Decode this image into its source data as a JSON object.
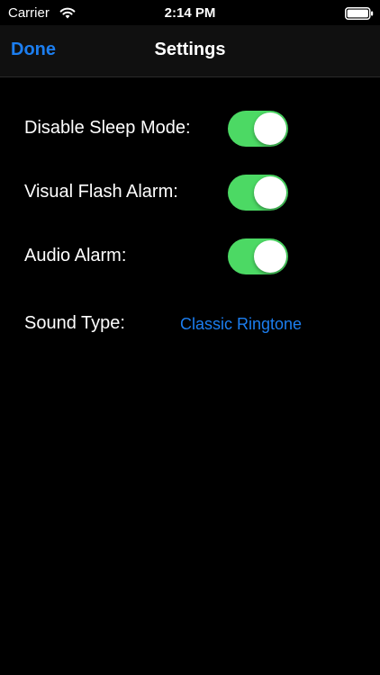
{
  "status_bar": {
    "carrier": "Carrier",
    "time": "2:14 PM",
    "wifi_icon": "wifi-icon",
    "battery_icon": "battery-icon"
  },
  "nav": {
    "done_label": "Done",
    "title": "Settings"
  },
  "settings": {
    "disable_sleep": {
      "label": "Disable Sleep Mode:",
      "on": true
    },
    "visual_flash": {
      "label": "Visual Flash Alarm:",
      "on": true
    },
    "audio_alarm": {
      "label": "Audio Alarm:",
      "on": true
    },
    "sound_type": {
      "label": "Sound Type:",
      "value": "Classic Ringtone"
    }
  },
  "colors": {
    "accent": "#1c7ef0",
    "toggle_on": "#4cd964",
    "background": "#000000",
    "nav_background": "#101010"
  }
}
